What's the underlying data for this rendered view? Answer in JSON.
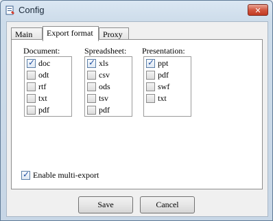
{
  "window": {
    "title": "Config"
  },
  "tabs": [
    {
      "label": "Main"
    },
    {
      "label": "Export format"
    },
    {
      "label": "Proxy"
    }
  ],
  "groups": [
    {
      "label": "Document:",
      "items": [
        {
          "label": "doc",
          "checked": true
        },
        {
          "label": "odt",
          "checked": false
        },
        {
          "label": "rtf",
          "checked": false
        },
        {
          "label": "txt",
          "checked": false
        },
        {
          "label": "pdf",
          "checked": false
        }
      ]
    },
    {
      "label": "Spreadsheet:",
      "items": [
        {
          "label": "xls",
          "checked": true
        },
        {
          "label": "csv",
          "checked": false
        },
        {
          "label": "ods",
          "checked": false
        },
        {
          "label": "tsv",
          "checked": false
        },
        {
          "label": "pdf",
          "checked": false
        }
      ]
    },
    {
      "label": "Presentation:",
      "items": [
        {
          "label": "ppt",
          "checked": true
        },
        {
          "label": "pdf",
          "checked": false
        },
        {
          "label": "swf",
          "checked": false
        },
        {
          "label": "txt",
          "checked": false
        }
      ]
    }
  ],
  "multi_export": {
    "label": "Enable multi-export",
    "checked": true
  },
  "buttons": {
    "save": "Save",
    "cancel": "Cancel"
  },
  "icons": {
    "app": "config-app-icon",
    "close": "close-icon",
    "check": "checkmark-icon"
  }
}
